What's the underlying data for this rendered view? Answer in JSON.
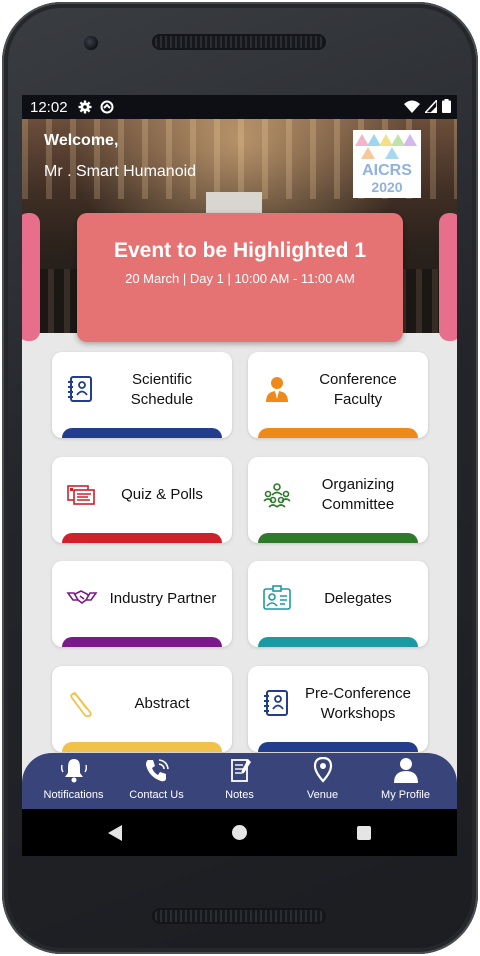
{
  "status_bar": {
    "time": "12:02"
  },
  "header": {
    "welcome": "Welcome,",
    "user_name": "Mr . Smart Humanoid",
    "logo_line1": "AICRS",
    "logo_line2": "2020"
  },
  "highlight": {
    "title": "Event to be Highlighted 1",
    "details": "20 March | Day 1 | 10:00 AM - 11:00 AM",
    "card_color": "#e57374",
    "side_color": "#e86f8c"
  },
  "menu": [
    {
      "label_line1": "Scientific",
      "label_line2": "Schedule",
      "icon": "schedule-book-icon",
      "bar_color": "#233c8c"
    },
    {
      "label_line1": "Conference",
      "label_line2": "Faculty",
      "icon": "faculty-person-icon",
      "bar_color": "#ef8a1a"
    },
    {
      "label_line1": "Quiz & Polls",
      "label_line2": "",
      "icon": "quiz-polls-icon",
      "bar_color": "#d0202a"
    },
    {
      "label_line1": "Organizing",
      "label_line2": "Committee",
      "icon": "committee-group-icon",
      "bar_color": "#2f7a2b"
    },
    {
      "label_line1": "Industry Partner",
      "label_line2": "",
      "icon": "handshake-icon",
      "bar_color": "#7a1a8a"
    },
    {
      "label_line1": "Delegates",
      "label_line2": "",
      "icon": "id-badge-icon",
      "bar_color": "#1c9aa4"
    },
    {
      "label_line1": "Abstract",
      "label_line2": "",
      "icon": "paperclip-icon",
      "bar_color": "#f0c24a"
    },
    {
      "label_line1": "Pre-Conference",
      "label_line2": "Workshops",
      "icon": "workshop-book-icon",
      "bar_color": "#233c8c"
    }
  ],
  "bottom_nav": [
    {
      "label": "Notifications",
      "icon": "bell-icon"
    },
    {
      "label": "Contact Us",
      "icon": "phone-icon"
    },
    {
      "label": "Notes",
      "icon": "notes-icon"
    },
    {
      "label": "Venue",
      "icon": "location-pin-icon"
    },
    {
      "label": "My Profile",
      "icon": "profile-icon"
    }
  ],
  "colors": {
    "bottom_nav_bg": "#39457a",
    "screen_bg": "#e8e8e8"
  }
}
